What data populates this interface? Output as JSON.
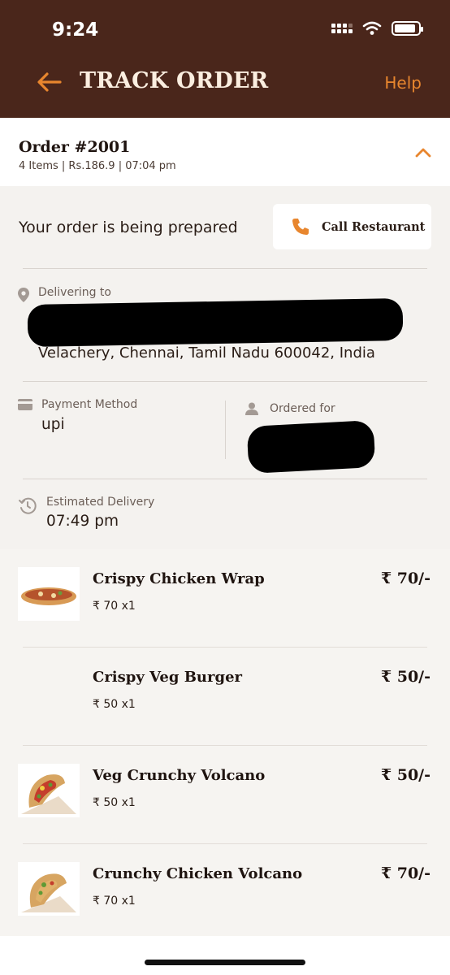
{
  "status_bar": {
    "time": "9:24"
  },
  "header": {
    "title": "TRACK ORDER",
    "help_label": "Help"
  },
  "order": {
    "id": "Order #2001",
    "meta": "4 Items | Rs.186.9 | 07:04 pm"
  },
  "status": {
    "text": "Your order is being prepared",
    "call_label": "Call Restaurant"
  },
  "delivery": {
    "label": "Delivering to",
    "address_line2": "Velachery, Chennai, Tamil Nadu 600042, India"
  },
  "payment": {
    "label": "Payment Method",
    "value": "upi"
  },
  "ordered_for": {
    "label": "Ordered for"
  },
  "estimated": {
    "label": "Estimated Delivery",
    "value": "07:49 pm"
  },
  "items": [
    {
      "name": "Crispy Chicken Wrap",
      "qty": "₹ 70 x1",
      "price": "₹ 70/-",
      "thumb": "wrap"
    },
    {
      "name": "Crispy Veg Burger",
      "qty": "₹ 50 x1",
      "price": "₹ 50/-",
      "thumb": "none"
    },
    {
      "name": "Veg Crunchy Volcano",
      "qty": "₹ 50 x1",
      "price": "₹ 50/-",
      "thumb": "taco"
    },
    {
      "name": "Crunchy Chicken Volcano",
      "qty": "₹ 70 x1",
      "price": "₹ 70/-",
      "thumb": "taco"
    }
  ],
  "colors": {
    "header_bg": "#4a261b",
    "accent": "#e8862e",
    "title": "#fbeee0"
  }
}
